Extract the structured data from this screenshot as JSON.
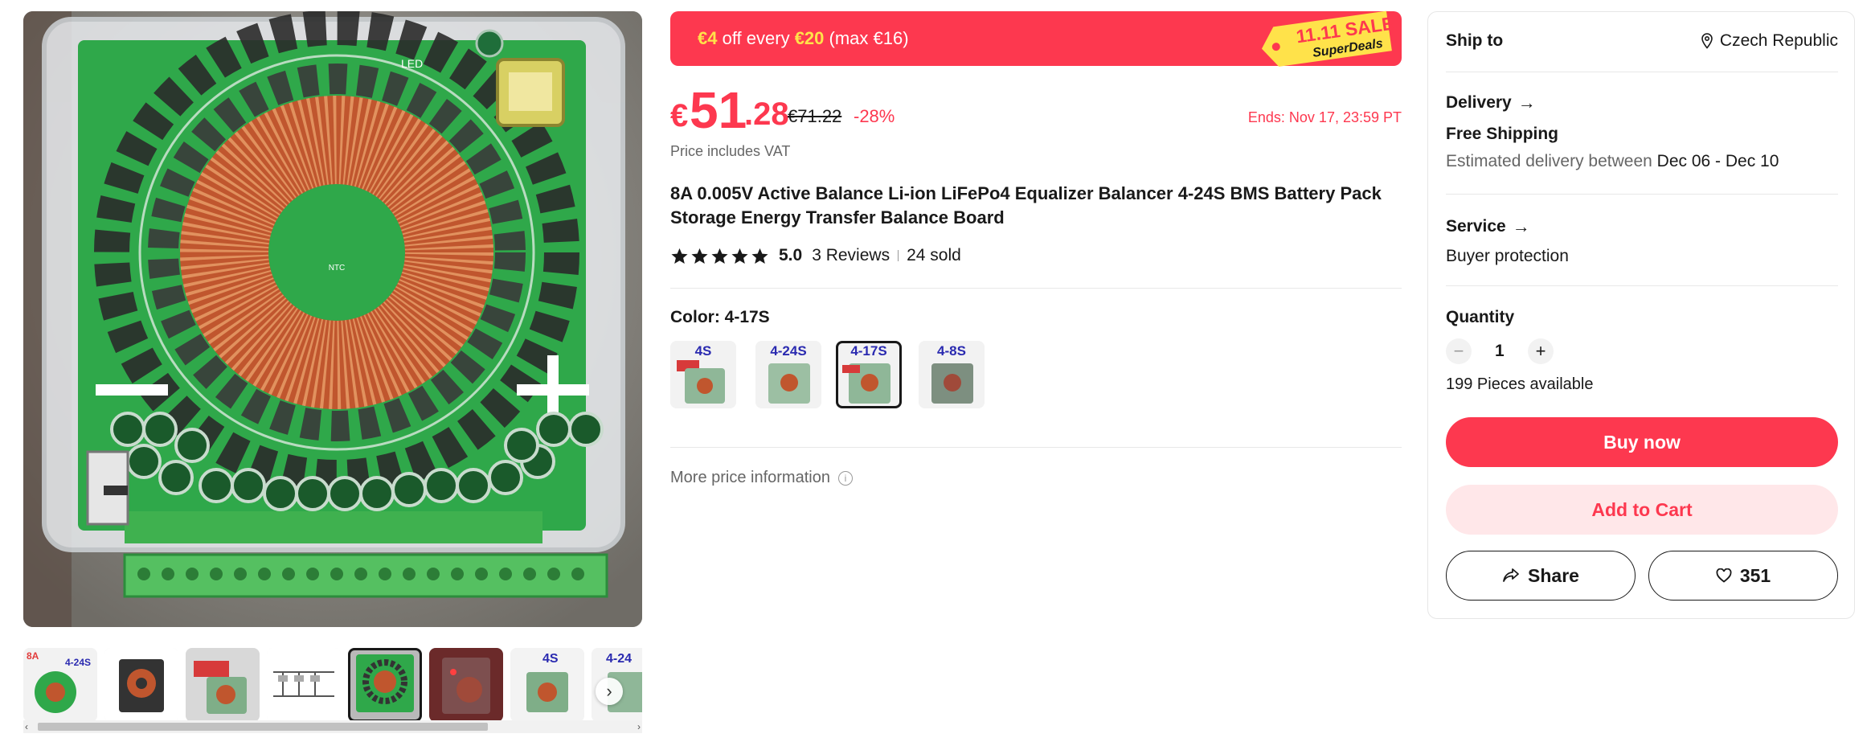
{
  "promo": {
    "amount_off": "€4",
    "off_every": " off every ",
    "threshold": "€20",
    "max": " (max €16)",
    "sale_tag_top": "11.11 SALE",
    "sale_tag_bottom": "SuperDeals"
  },
  "price": {
    "currency": "€",
    "integer": "51",
    "decimal": ".28",
    "original": "€71.22",
    "discount": "-28%",
    "ends": "Ends: Nov 17, 23:59 PT",
    "vat_note": "Price includes VAT"
  },
  "product": {
    "title": "8A 0.005V Active Balance Li-ion LiFePo4 Equalizer Balancer 4-24S BMS Battery Pack Storage Energy Transfer Balance Board",
    "rating": "5.0",
    "stars": 5,
    "reviews": "3 Reviews",
    "sold": "24 sold"
  },
  "color": {
    "label": "Color: 4-17S",
    "options": [
      "4S",
      "4-24S",
      "4-17S",
      "4-8S"
    ],
    "selected": "4-17S"
  },
  "more_price_info": "More price information",
  "gallery": {
    "main_image_text": "LED",
    "ntc_label": "NTC",
    "thumb_labels": [
      "8A",
      "4-24S",
      "4S",
      "4-24"
    ]
  },
  "shipping": {
    "ship_to_label": "Ship to",
    "country": "Czech Republic",
    "delivery_label": "Delivery",
    "free_shipping": "Free Shipping",
    "estimate_prefix": "Estimated delivery between",
    "estimate_dates": "Dec 06 - Dec 10"
  },
  "service": {
    "label": "Service",
    "value": "Buyer protection"
  },
  "quantity": {
    "label": "Quantity",
    "value": "1",
    "available": "199 Pieces available",
    "minus": "−",
    "plus": "+"
  },
  "actions": {
    "buy_now": "Buy now",
    "add_to_cart": "Add to Cart",
    "share": "Share",
    "wishlist_count": "351"
  },
  "colors": {
    "accent": "#fd384f",
    "accent_light": "#ffe7e9",
    "promo_highlight": "#ffe24a",
    "pcb_green": "#2fa84a"
  }
}
